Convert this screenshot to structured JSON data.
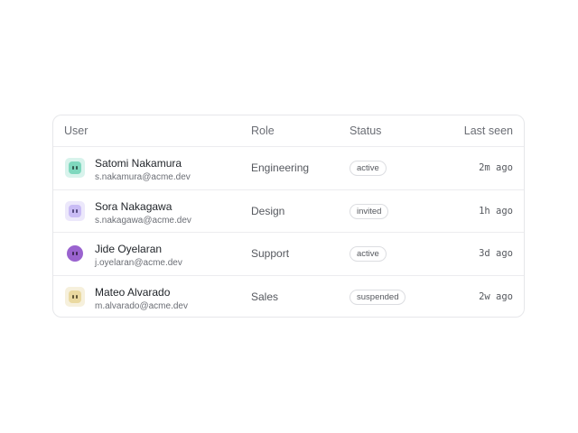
{
  "columns": {
    "user": "User",
    "role": "Role",
    "status": "Status",
    "last_seen": "Last seen"
  },
  "users": [
    {
      "name": "Satomi Nakamura",
      "email": "s.nakamura@acme.dev",
      "role": "Engineering",
      "status": "active",
      "last_seen": "2m ago",
      "avatar": {
        "shape": "rounded-square",
        "bg": "#d8f3ec",
        "face": "#7fd8be",
        "eye": "#1f3b35",
        "icon": "face-avatar-icon"
      }
    },
    {
      "name": "Sora Nakagawa",
      "email": "s.nakagawa@acme.dev",
      "role": "Design",
      "status": "invited",
      "last_seen": "1h ago",
      "avatar": {
        "shape": "rounded-square",
        "bg": "#ece8fb",
        "face": "#c9bcf5",
        "eye": "#3a2f66",
        "icon": "face-avatar-icon"
      }
    },
    {
      "name": "Jide Oyelaran",
      "email": "j.oyelaran@acme.dev",
      "role": "Support",
      "status": "active",
      "last_seen": "3d ago",
      "avatar": {
        "shape": "circle",
        "bg": "#ffffff",
        "face": "#9a63cf",
        "eye": "#2b1a3d",
        "icon": "face-avatar-icon"
      }
    },
    {
      "name": "Mateo Alvarado",
      "email": "m.alvarado@acme.dev",
      "role": "Sales",
      "status": "suspended",
      "last_seen": "2w ago",
      "avatar": {
        "shape": "rounded-square",
        "bg": "#f6f0dc",
        "face": "#ead9a0",
        "eye": "#3d3419",
        "icon": "face-avatar-icon"
      }
    }
  ]
}
